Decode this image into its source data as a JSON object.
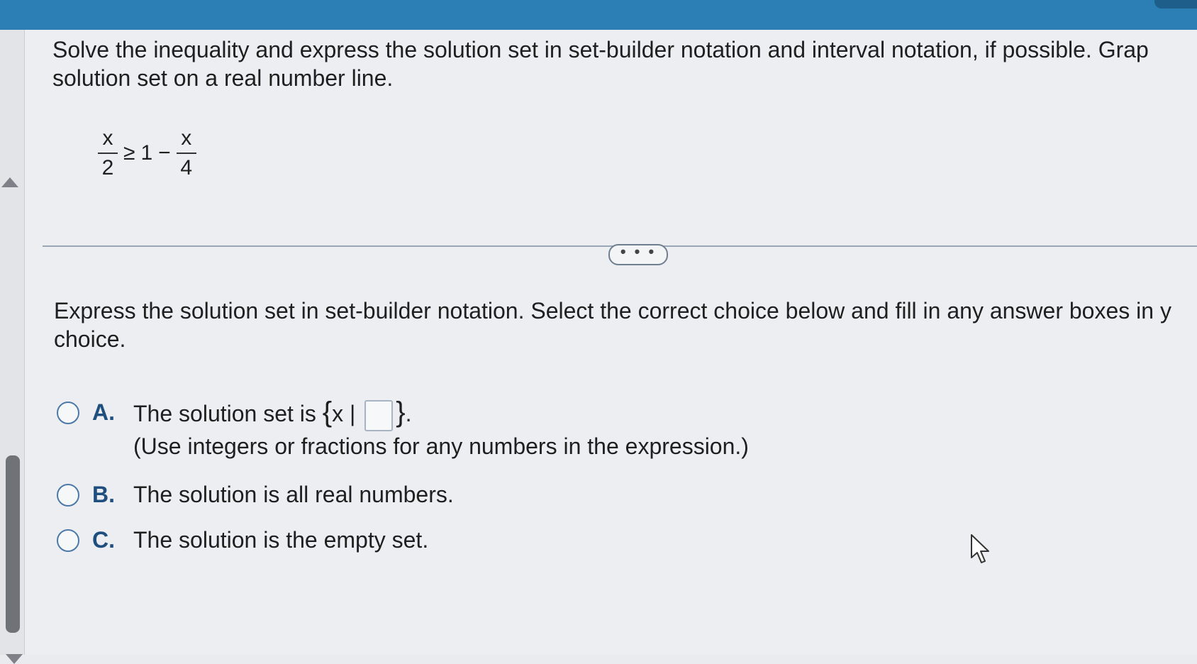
{
  "question": {
    "line1": "Solve the inequality and express the solution set in set-builder notation and interval notation, if possible. Grap",
    "line2": "solution set on a real number line."
  },
  "equation": {
    "lhs_num": "x",
    "lhs_den": "2",
    "op": "≥",
    "constant": "1",
    "minus": "−",
    "rhs_num": "x",
    "rhs_den": "4"
  },
  "more_button": {
    "label": "• • •"
  },
  "instruction": {
    "line1": "Express the solution set in set-builder notation. Select the correct choice below and fill in any answer boxes in y",
    "line2": "choice."
  },
  "choices": [
    {
      "letter": "A.",
      "text_before": "The solution set is",
      "open_brace": "{",
      "set_var": "x |",
      "close_brace": "}",
      "period": ".",
      "hint": "(Use integers or fractions for any numbers in the expression.)",
      "answer_value": ""
    },
    {
      "letter": "B.",
      "text": "The solution is all real numbers."
    },
    {
      "letter": "C.",
      "text": "The solution is the empty set."
    }
  ]
}
